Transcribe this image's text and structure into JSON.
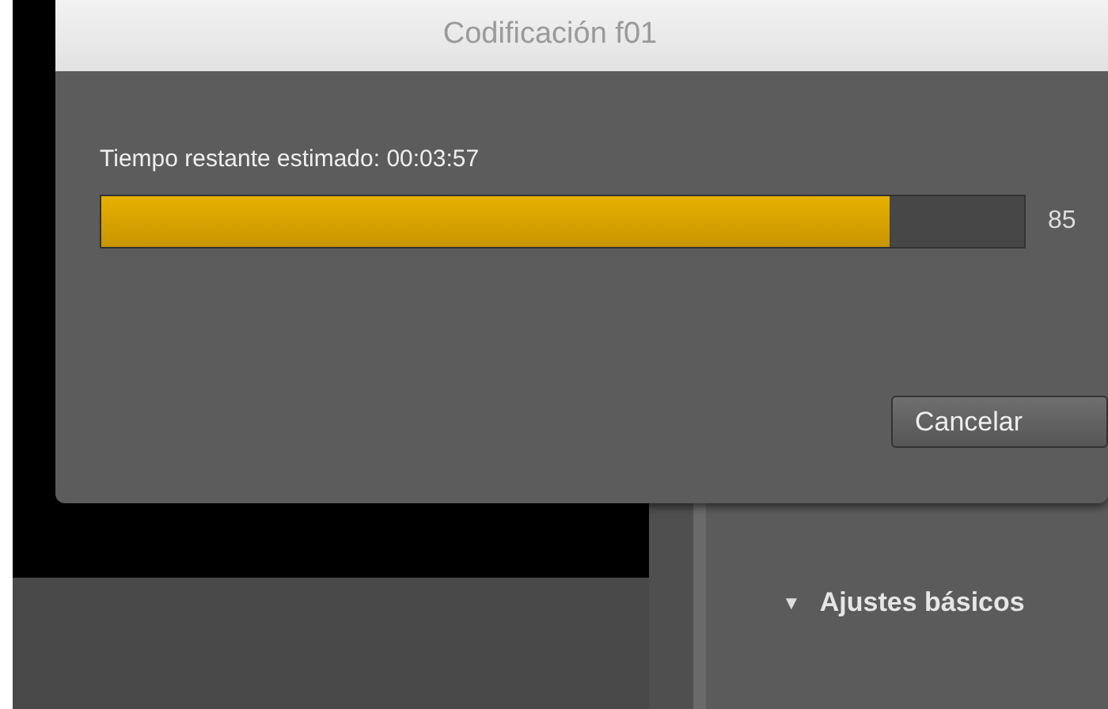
{
  "dialog": {
    "title": "Codificación f01",
    "status": "Tiempo restante estimado: 00:03:57",
    "progress": {
      "level": 0.855,
      "reading": "85"
    },
    "buttons": [
      "Cancelar"
    ]
  },
  "panel": {
    "section": {
      "title": "Ajustes básicos",
      "expanded": true,
      "toggle": "▼"
    }
  }
}
